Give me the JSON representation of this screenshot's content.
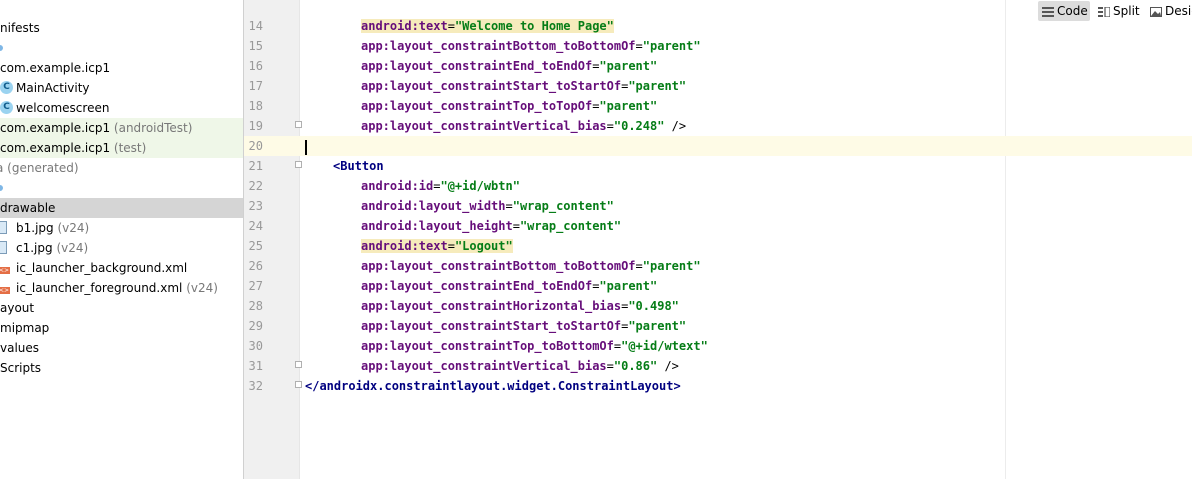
{
  "tree": {
    "items": [
      {
        "text": "nifests",
        "hint": ""
      },
      {
        "text": "",
        "hint": ""
      },
      {
        "text": "com.example.icp1",
        "hint": ""
      },
      {
        "text": "MainActivity",
        "hint": ""
      },
      {
        "text": "welcomescreen",
        "hint": ""
      },
      {
        "text": "com.example.icp1",
        "hint": " (androidTest)"
      },
      {
        "text": "com.example.icp1",
        "hint": " (test)"
      },
      {
        "text": "",
        "hint": "a (generated)"
      },
      {
        "text": "",
        "hint": ""
      },
      {
        "text": "drawable",
        "hint": ""
      },
      {
        "text": "b1.jpg",
        "hint": " (v24)"
      },
      {
        "text": "c1.jpg",
        "hint": " (v24)"
      },
      {
        "text": "ic_launcher_background.xml",
        "hint": ""
      },
      {
        "text": "ic_launcher_foreground.xml",
        "hint": " (v24)"
      },
      {
        "text": "ayout",
        "hint": ""
      },
      {
        "text": "mipmap",
        "hint": ""
      },
      {
        "text": "values",
        "hint": ""
      },
      {
        "text": "Scripts",
        "hint": ""
      }
    ]
  },
  "view_modes": [
    {
      "label": "Code",
      "icon": "code-view-icon"
    },
    {
      "label": "Split",
      "icon": "split-view-icon"
    },
    {
      "label": "Desig",
      "icon": "design-view-icon"
    }
  ],
  "editor": {
    "lines": [
      {
        "n": "14",
        "a": "android:text",
        "eq": "=",
        "v": "\"Welcome to Home Page\"",
        "tail": ""
      },
      {
        "n": "15",
        "a": "app:layout_constraintBottom_toBottomOf",
        "eq": "=",
        "v": "\"parent\"",
        "tail": ""
      },
      {
        "n": "16",
        "a": "app:layout_constraintEnd_toEndOf",
        "eq": "=",
        "v": "\"parent\"",
        "tail": ""
      },
      {
        "n": "17",
        "a": "app:layout_constraintStart_toStartOf",
        "eq": "=",
        "v": "\"parent\"",
        "tail": ""
      },
      {
        "n": "18",
        "a": "app:layout_constraintTop_toTopOf",
        "eq": "=",
        "v": "\"parent\"",
        "tail": ""
      },
      {
        "n": "19",
        "a": "app:layout_constraintVertical_bias",
        "eq": "=",
        "v": "\"0.248\"",
        "tail": " />"
      },
      {
        "n": "20",
        "a": "",
        "eq": "",
        "v": "",
        "tail": ""
      },
      {
        "n": "21",
        "a": "",
        "eq": "",
        "v": "",
        "tail": "",
        "tag": "<Button"
      },
      {
        "n": "22",
        "a": "android:id",
        "eq": "=",
        "v": "\"@+id/wbtn\"",
        "tail": ""
      },
      {
        "n": "23",
        "a": "android:layout_width",
        "eq": "=",
        "v": "\"wrap_content\"",
        "tail": ""
      },
      {
        "n": "24",
        "a": "android:layout_height",
        "eq": "=",
        "v": "\"wrap_content\"",
        "tail": ""
      },
      {
        "n": "25",
        "a": "android:text",
        "eq": "=",
        "v": "\"Logout\"",
        "tail": ""
      },
      {
        "n": "26",
        "a": "app:layout_constraintBottom_toBottomOf",
        "eq": "=",
        "v": "\"parent\"",
        "tail": ""
      },
      {
        "n": "27",
        "a": "app:layout_constraintEnd_toEndOf",
        "eq": "=",
        "v": "\"parent\"",
        "tail": ""
      },
      {
        "n": "28",
        "a": "app:layout_constraintHorizontal_bias",
        "eq": "=",
        "v": "\"0.498\"",
        "tail": ""
      },
      {
        "n": "29",
        "a": "app:layout_constraintStart_toStartOf",
        "eq": "=",
        "v": "\"parent\"",
        "tail": ""
      },
      {
        "n": "30",
        "a": "app:layout_constraintTop_toBottomOf",
        "eq": "=",
        "v": "\"@+id/wtext\"",
        "tail": ""
      },
      {
        "n": "31",
        "a": "app:layout_constraintVertical_bias",
        "eq": "=",
        "v": "\"0.86\"",
        "tail": " />"
      },
      {
        "n": "32",
        "a": "",
        "eq": "",
        "v": "",
        "tail": "",
        "tag": "</androidx.constraintlayout.widget.ConstraintLayout>"
      }
    ]
  },
  "colors": {
    "attribute": "#660e7a",
    "string_value": "#067d17",
    "tag": "#000080",
    "selected_row": "#d5d5d5",
    "test_row": "#eff7e8",
    "current_line": "#fefbe6"
  }
}
